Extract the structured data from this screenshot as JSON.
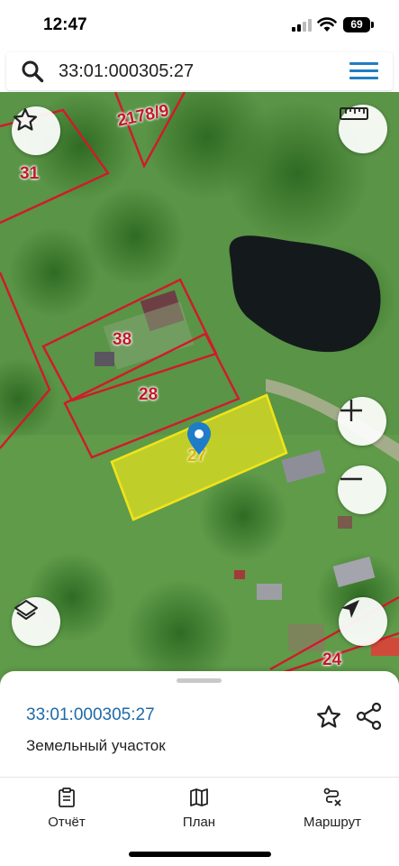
{
  "status_bar": {
    "time": "12:47",
    "battery": "69"
  },
  "search": {
    "query": "33:01:000305:27"
  },
  "map": {
    "parcel_labels": {
      "p2178": "2178/9",
      "p31": "31",
      "p38": "38",
      "p28": "28",
      "p27": "27",
      "p24": "24"
    },
    "selected_color": "#e6e21e",
    "boundary_color": "#d11a2a"
  },
  "sheet": {
    "cadastral_number": "33:01:000305:27",
    "object_type": "Земельный участок"
  },
  "tabs": [
    {
      "label": "Отчёт",
      "icon": "clipboard-icon"
    },
    {
      "label": "План",
      "icon": "map-icon"
    },
    {
      "label": "Маршрут",
      "icon": "route-icon"
    }
  ]
}
